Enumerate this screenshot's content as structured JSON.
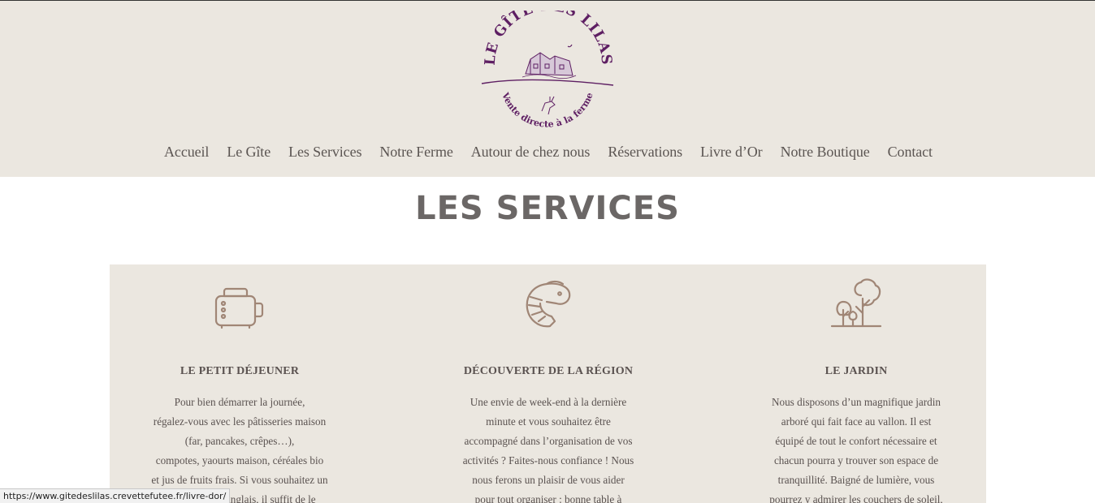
{
  "logo": {
    "top_text": "LE GÎTE DES LILAS",
    "bottom_text": "Vente directe à la ferme",
    "color": "#5e1f63"
  },
  "nav": {
    "items": [
      "Accueil",
      "Le Gîte",
      "Les Services",
      "Notre Ferme",
      "Autour de chez nous",
      "Réservations",
      "Livre d’Or",
      "Notre Boutique",
      "Contact"
    ]
  },
  "page": {
    "title": "LES SERVICES"
  },
  "services": [
    {
      "icon": "toaster-icon",
      "title": "LE PETIT DÉJEUNER",
      "lines": [
        "Pour bien démarrer la journée,",
        "régalez-vous avec les pâtisseries maison",
        "(far, pancakes, crêpes…),",
        "compotes, yaourts maison, céréales bio",
        "et jus de fruits frais. Si vous souhaitez un",
        "petit-déjeuner anglais, il suffit de le"
      ]
    },
    {
      "icon": "shrimp-icon",
      "title": "DÉCOUVERTE DE LA RÉGION",
      "lines": [
        "Une envie de week-end à la dernière",
        "minute et vous souhaitez être",
        "accompagné dans l’organisation de vos",
        "activités ? Faites-nous confiance ! Nous",
        "nous ferons un plaisir de vous aider",
        "pour tout organiser : bonne table à"
      ]
    },
    {
      "icon": "trees-icon",
      "title": "LE JARDIN",
      "lines": [
        "Nous disposons d’un magnifique jardin",
        "arboré qui fait face au vallon. Il est",
        "équipé de tout le confort nécessaire et",
        "chacun pourra y trouver son espace de",
        "tranquillité. Baigné de lumière, vous",
        "pourrez y admirer les couchers de soleil,"
      ]
    }
  ],
  "status_bar": {
    "url": "https://www.gitedeslilas.crevettefutee.fr/livre-dor/"
  },
  "colors": {
    "header_bg": "#ebe7e0",
    "icon": "#a08676",
    "text": "#5a5250",
    "title": "#6b6766"
  }
}
